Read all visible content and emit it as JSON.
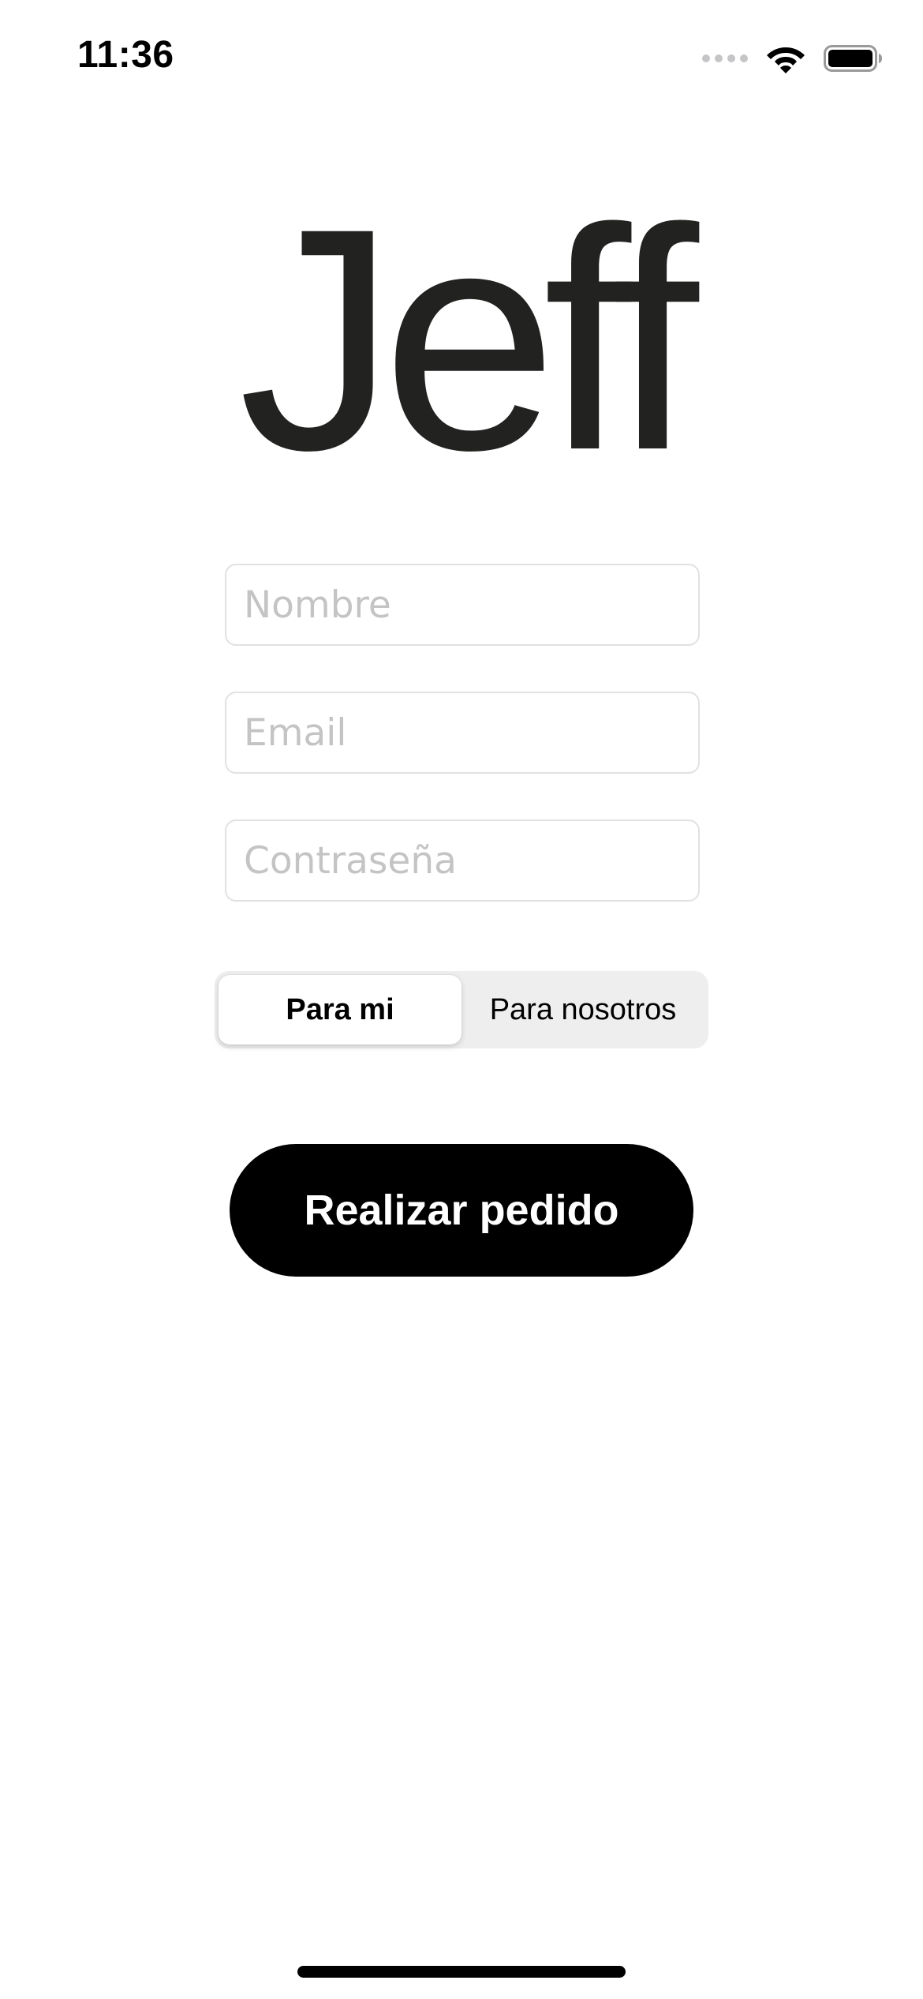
{
  "status_bar": {
    "time": "11:36",
    "icons": [
      "cellular-signal-icon",
      "wifi-icon",
      "battery-icon"
    ]
  },
  "logo": {
    "text": "Jeff",
    "color": "#222220"
  },
  "form": {
    "name_placeholder": "Nombre",
    "email_placeholder": "Email",
    "password_placeholder": "Contraseña"
  },
  "segmented_control": {
    "options": [
      "Para mi",
      "Para nosotros"
    ],
    "selected": "Para mi"
  },
  "submit_button": {
    "label": "Realizar pedido"
  },
  "colors": {
    "background": "#ffffff",
    "button": "#000000",
    "placeholder": "#c4c4c4",
    "field_border": "#e1e1e1",
    "segment_track": "#eeeeef"
  }
}
